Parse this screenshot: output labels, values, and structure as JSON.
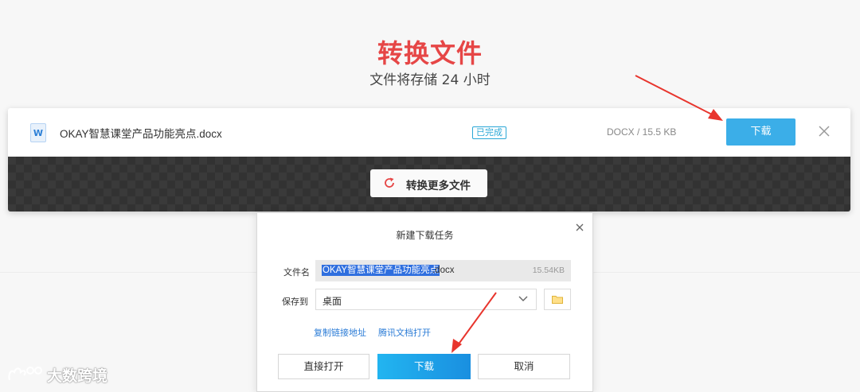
{
  "header": {
    "title": "转换文件",
    "subtitle": "文件将存储 24 小时"
  },
  "file": {
    "name": "OKAY智慧课堂产品功能亮点.docx",
    "status": "已完成",
    "meta": "DOCX / 15.5 KB",
    "download_label": "下载",
    "icon": "word-doc-icon"
  },
  "convert_more": {
    "label": "转换更多文件",
    "icon": "refresh-icon"
  },
  "dialog": {
    "title": "新建下载任务",
    "filename_label": "文件名",
    "filename_selected": "OKAY智慧课堂产品功能亮点",
    "filename_ext": ".docx",
    "filesize": "15.54KB",
    "saveto_label": "保存到",
    "saveto_value": "桌面",
    "link_copy": "复制链接地址",
    "link_tencent": "腾讯文档打开",
    "btn_open": "直接打开",
    "btn_download": "下载",
    "btn_cancel": "取消"
  },
  "watermark": {
    "text": "大数跨境"
  },
  "colors": {
    "title_red": "#e64646",
    "accent_blue": "#3baee8",
    "arrow_red": "#e8352d"
  }
}
